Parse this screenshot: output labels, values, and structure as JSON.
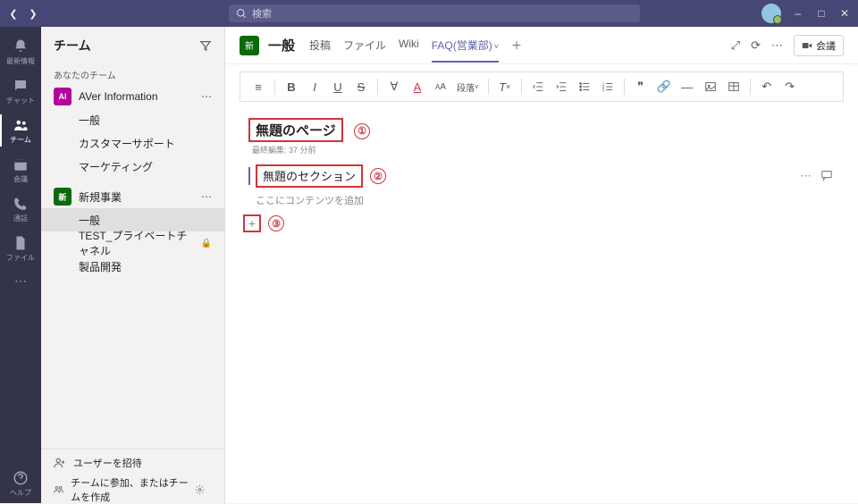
{
  "titlebar": {
    "search_placeholder": "検索"
  },
  "rail": {
    "activity": "最新情報",
    "chat": "チャット",
    "teams": "チーム",
    "meetings": "会議",
    "calls": "通話",
    "files": "ファイル",
    "help": "ヘルプ"
  },
  "sidebar": {
    "title": "チーム",
    "section": "あなたのチーム",
    "team1": {
      "initial": "AI",
      "name": "AVer Information",
      "channels": [
        "一般",
        "カスタマーサポート",
        "マーケティング"
      ]
    },
    "team2": {
      "initial": "新",
      "name": "新規事業",
      "channels": {
        "general": "一般",
        "priv": "TEST_プライベートチャネル",
        "dev": "製品開発"
      }
    },
    "invite": "ユーザーを招待",
    "joincreate": "チームに参加、またはチームを作成"
  },
  "header": {
    "chan_initial": "新",
    "chan_name": "一般",
    "tabs": {
      "posts": "投稿",
      "files": "ファイル",
      "wiki": "Wiki",
      "faq": "FAQ(営業部)"
    },
    "meet": "会議"
  },
  "toolbar": {
    "para": "段落"
  },
  "editor": {
    "page_title": "無題のページ",
    "callout1": "①",
    "lastedit": "最終編集: 37 分前",
    "section_title": "無題のセクション",
    "callout2": "②",
    "placeholder": "ここにコンテンツを追加",
    "callout3": "③"
  }
}
